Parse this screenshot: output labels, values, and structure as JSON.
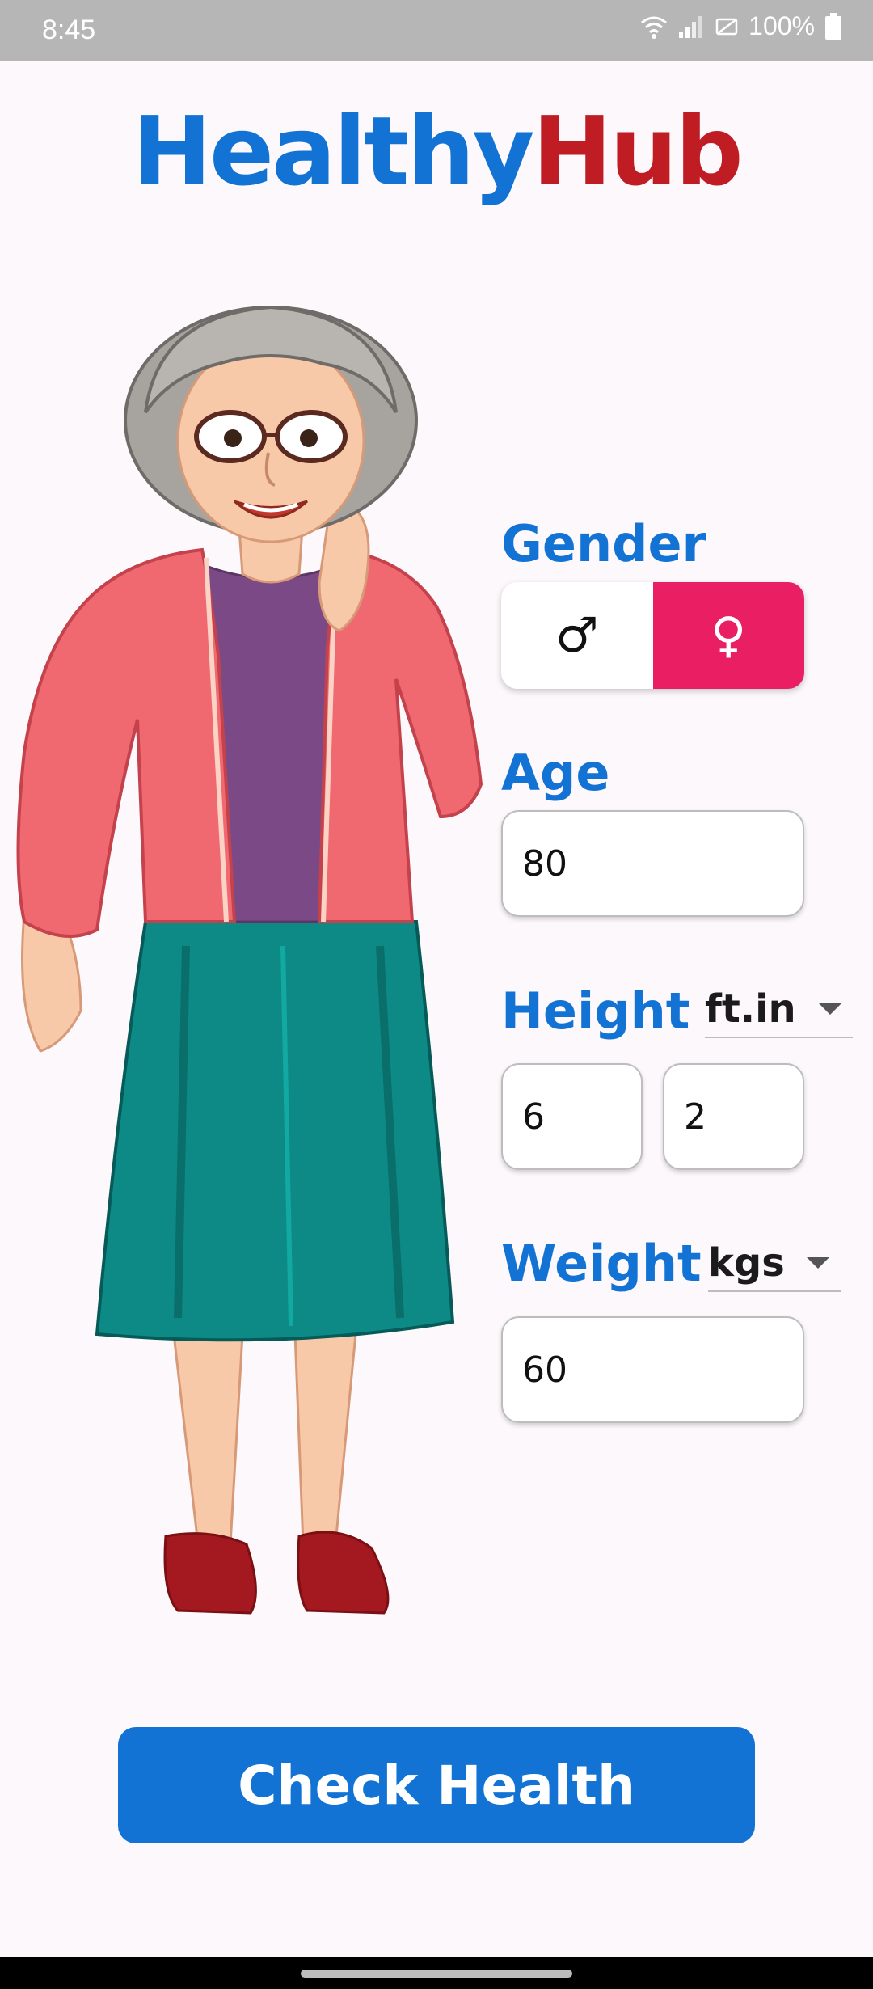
{
  "status_bar": {
    "time": "8:45",
    "battery": "100%"
  },
  "app": {
    "logo_part1": "Healthy",
    "logo_part2": "Hub"
  },
  "colors": {
    "primary": "#1273d4",
    "logo_red": "#c01c24",
    "female_accent": "#e91e63"
  },
  "gender": {
    "label": "Gender",
    "male_symbol": "♂",
    "female_symbol": "♀",
    "selected": "female"
  },
  "age": {
    "label": "Age",
    "value": "80"
  },
  "height": {
    "label": "Height",
    "unit": "ft.in",
    "feet": "6",
    "inches": "2"
  },
  "weight": {
    "label": "Weight",
    "unit": "kgs",
    "value": "60"
  },
  "action": {
    "label": "Check Health"
  }
}
